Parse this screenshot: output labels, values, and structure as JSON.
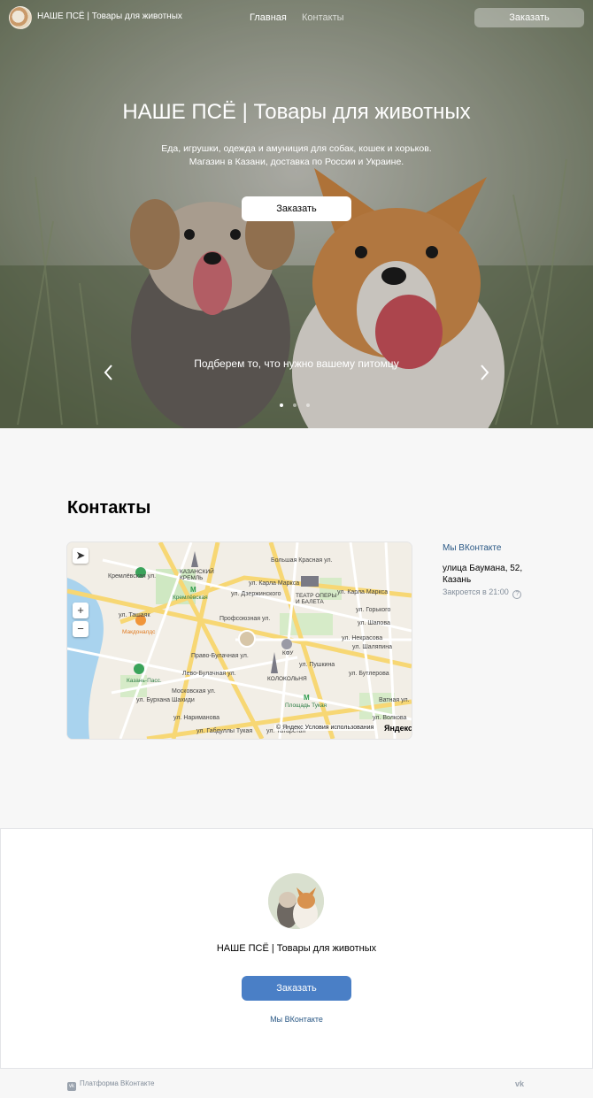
{
  "header": {
    "brand": "НАШЕ ПСЁ | Товары для животных",
    "nav": [
      "Главная",
      "Контакты"
    ],
    "order_button": "Заказать"
  },
  "hero": {
    "title": "НАШЕ ПСЁ | Товары для животных",
    "subtitle_line1": "Еда, игрушки, одежда и амуниция для собак, кошек и хорьков.",
    "subtitle_line2": "Магазин в Казани, доставка по России и Украине.",
    "button": "Заказать",
    "slide_caption": "Подберем то, что нужно вашему питомцу",
    "slides_total": 3,
    "slide_active": 1
  },
  "contacts": {
    "title": "Контакты",
    "vk_link": "Мы ВКонтакте",
    "address_line1": "улица Баумана, 52,",
    "address_line2": "Казань",
    "hours": "Закроется в 21:00",
    "map": {
      "streets": [
        "Большая Красная ул.",
        "ул. Карла Маркса",
        "ул. Карла Маркса",
        "ул. Дзержинского",
        "ул. Горького",
        "Кремлёвская ул.",
        "ул. Ташаяк",
        "Профсоюзная ул.",
        "Право-Булачная ул.",
        "Лево-Булачная ул.",
        "Московская ул.",
        "ул. Пушкина",
        "ул. Некрасова",
        "ул. Бутлерова",
        "ул. Шаляпина",
        "ул. Татарстан",
        "ул. Габдуллы Тукая",
        "ул. Нариманова",
        "ул. Бурхана Шахиди",
        "ул. Шапова",
        "Ватная ул.",
        "ул. Волкова"
      ],
      "places": [
        "Казанский кремль",
        "Кремлёвская",
        "Театр оперы и балета",
        "Макдоналдс",
        "КФУ",
        "Колокольня",
        "Казань-Пасс.",
        "Площадь Тукая"
      ],
      "credit": "© Яндекс Условия использования",
      "provider": "Яндекс",
      "zoom_in": "+",
      "zoom_out": "−"
    }
  },
  "footer": {
    "name": "НАШЕ ПСЁ | Товары для животных",
    "button": "Заказать",
    "vk_link": "Мы ВКонтакте"
  },
  "platform": {
    "label": "Платформа ВКонтакте"
  },
  "colors": {
    "accent": "#4a7fc6",
    "link": "#2a5885",
    "muted": "#818c99",
    "page_bg": "#f7f7f7"
  }
}
